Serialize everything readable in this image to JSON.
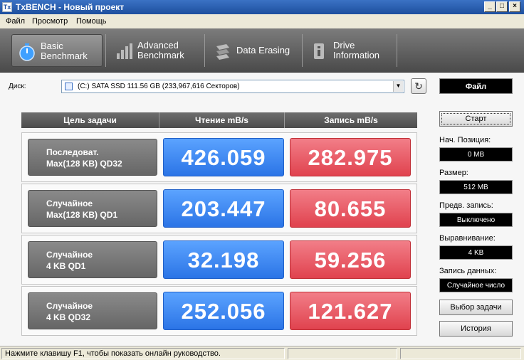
{
  "window": {
    "title": "TxBENCH - Новый проект",
    "buttons": {
      "minimize": "_",
      "maximize": "□",
      "close": "×"
    }
  },
  "menu": [
    {
      "label": "Файл"
    },
    {
      "label": "Просмотр"
    },
    {
      "label": "Помощь"
    }
  ],
  "toolbar": {
    "tabs": [
      {
        "line1": "Basic",
        "line2": "Benchmark",
        "icon": "stopwatch-icon",
        "active": true
      },
      {
        "line1": "Advanced",
        "line2": "Benchmark",
        "icon": "bar-chart-icon",
        "active": false
      },
      {
        "line1": "Data Erasing",
        "line2": "",
        "icon": "eraser-icon",
        "active": false
      },
      {
        "line1": "Drive",
        "line2": "Information",
        "icon": "drive-info-icon",
        "active": false
      }
    ]
  },
  "disk": {
    "label": "Диск:",
    "selected": "(C:) SATA SSD  111.56 GB (233,967,616 Секторов)"
  },
  "table": {
    "headers": {
      "task": "Цель задачи",
      "read": "Чтение mB/s",
      "write": "Запись mB/s"
    },
    "rows": [
      {
        "line1": "Последоват.",
        "line2": "Max(128 KB) QD32",
        "read": "426.059",
        "write": "282.975"
      },
      {
        "line1": "Случайное",
        "line2": "Max(128 KB) QD1",
        "read": "203.447",
        "write": "80.655"
      },
      {
        "line1": "Случайное",
        "line2": "4 KB QD1",
        "read": "32.198",
        "write": "59.256"
      },
      {
        "line1": "Случайное",
        "line2": "4 KB QD32",
        "read": "252.056",
        "write": "121.627"
      }
    ]
  },
  "panel": {
    "file_label": "Файл",
    "start_label": "Старт",
    "start_pos_label": "Нач. Позиция:",
    "start_pos_value": "0 MB",
    "size_label": "Размер:",
    "size_value": "512 MB",
    "prewrite_label": "Предв. запись:",
    "prewrite_value": "Выключено",
    "align_label": "Выравнивание:",
    "align_value": "4 KB",
    "data_label": "Запись данных:",
    "data_value": "Случайное число",
    "select_task_label": "Выбор задачи",
    "history_label": "История"
  },
  "status": {
    "hint": "Нажмите клавишу F1, чтобы показать онлайн руководство."
  },
  "colors": {
    "read": "#2b74e6",
    "write": "#e0424e",
    "header": "#555555"
  }
}
